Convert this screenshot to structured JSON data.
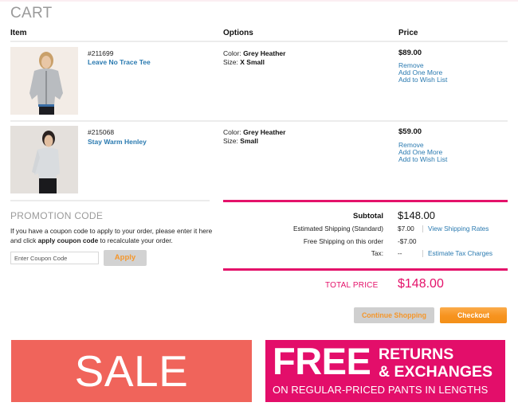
{
  "page": {
    "title": "CART"
  },
  "columns": {
    "item": "Item",
    "options": "Options",
    "price": "Price"
  },
  "items": [
    {
      "sku": "#211699",
      "name": "Leave No Trace Tee",
      "color_label": "Color:",
      "color": "Grey Heather",
      "size_label": "Size:",
      "size": "X Small",
      "price": "$89.00",
      "image": "woman-grey-zip-hoodie-photo",
      "actions": [
        "Remove",
        "Add One More",
        "Add to Wish List"
      ]
    },
    {
      "sku": "#215068",
      "name": "Stay Warm Henley",
      "color_label": "Color:",
      "color": "Grey Heather",
      "size_label": "Size:",
      "size": "Small",
      "price": "$59.00",
      "image": "woman-grey-henley-photo",
      "actions": [
        "Remove",
        "Add One More",
        "Add to Wish List"
      ]
    }
  ],
  "promo": {
    "title": "PROMOTION CODE",
    "text_before": "If you have a coupon code to apply to your order, please enter it here and click ",
    "text_bold": "apply coupon code",
    "text_after": " to recalculate your order.",
    "input_placeholder": "Enter Coupon Code",
    "input_value": "",
    "apply_label": "Apply"
  },
  "summary": {
    "subtotal_label": "Subtotal",
    "subtotal": "$148.00",
    "shipping_label": "Estimated Shipping (Standard)",
    "shipping": "$7.00",
    "shipping_link": "View Shipping Rates",
    "free_shipping_label": "Free Shipping on this order",
    "free_shipping": "-$7.00",
    "tax_label": "Tax:",
    "tax": "--",
    "tax_link": "Estimate Tax Charges",
    "total_label": "TOTAL PRICE",
    "total": "$148.00"
  },
  "buttons": {
    "continue": "Continue Shopping",
    "checkout": "Checkout"
  },
  "banners": {
    "sale": "SALE",
    "free_big": "FREE",
    "free_line1": "RETURNS",
    "free_line2": "& EXCHANGES",
    "free_sub": "ON REGULAR-PRICED PANTS IN LENGTHS"
  },
  "colors": {
    "accent_pink": "#e4126a",
    "accent_orange": "#f7931e",
    "link_blue": "#2a7ab0",
    "sale_red": "#f0645b"
  }
}
